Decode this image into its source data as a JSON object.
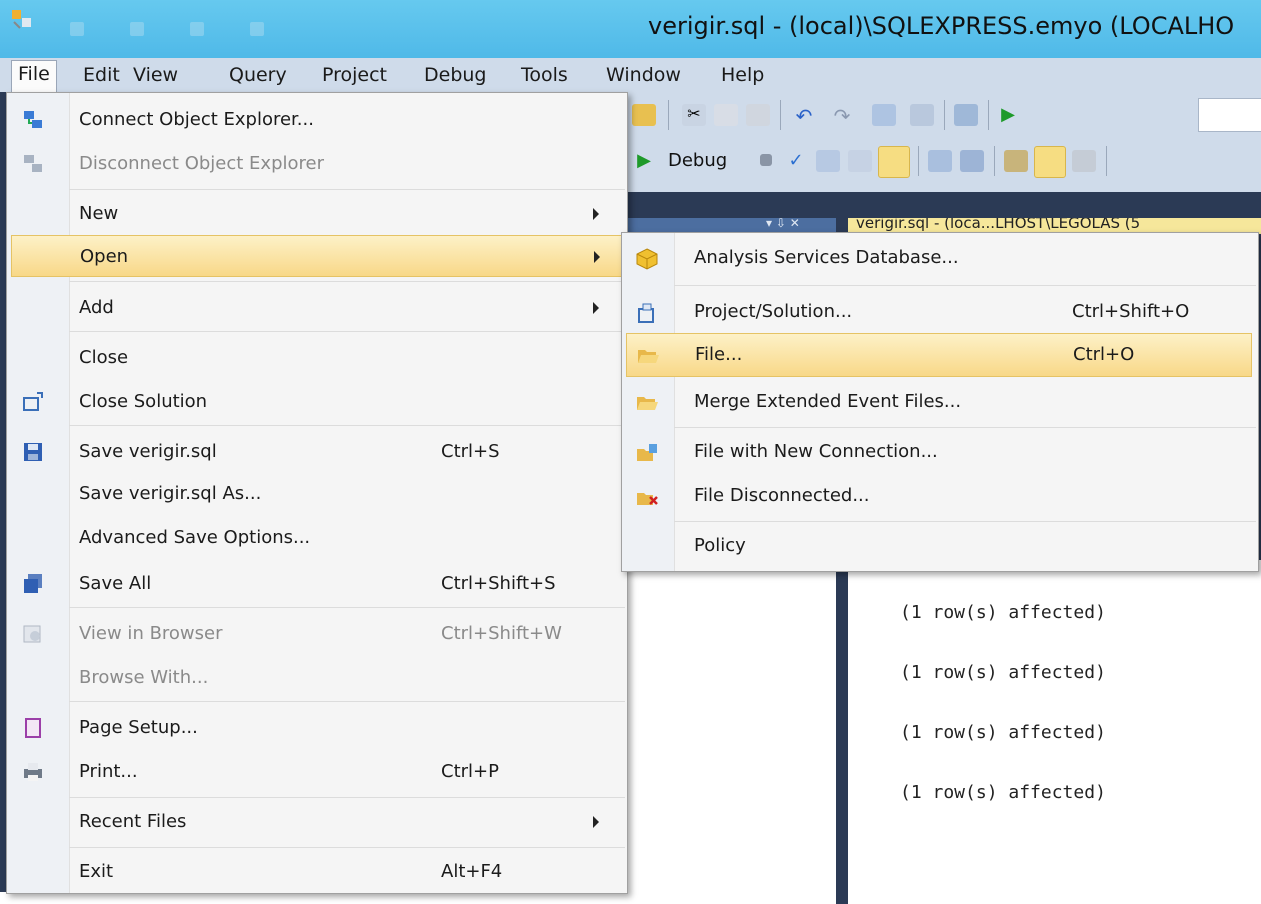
{
  "window": {
    "title": "verigir.sql - (local)\\SQLEXPRESS.emyo (LOCALHO"
  },
  "menubar": {
    "items": [
      "File",
      "Edit",
      "View",
      "Query",
      "Project",
      "Debug",
      "Tools",
      "Window",
      "Help"
    ],
    "active": "File"
  },
  "toolbar": {
    "debug_label": "Debug"
  },
  "panel": {
    "pin_label": "▾ ⇩ ✕"
  },
  "tab": {
    "title": "verigir.sql - (loca...LHOST\\LEGOLAS (5"
  },
  "file_menu": {
    "items": [
      {
        "label": "Connect Object Explorer...",
        "shortcut": "",
        "disabled": false
      },
      {
        "label": "Disconnect Object Explorer",
        "shortcut": "",
        "disabled": true
      },
      {
        "label": "New",
        "shortcut": "",
        "disabled": false
      },
      {
        "label": "Open",
        "shortcut": "",
        "disabled": false
      },
      {
        "label": "Add",
        "shortcut": "",
        "disabled": false
      },
      {
        "label": "Close",
        "shortcut": "",
        "disabled": false
      },
      {
        "label": "Close Solution",
        "shortcut": "",
        "disabled": false
      },
      {
        "label": "Save verigir.sql",
        "shortcut": "Ctrl+S",
        "disabled": false
      },
      {
        "label": "Save verigir.sql As...",
        "shortcut": "",
        "disabled": false
      },
      {
        "label": "Advanced Save Options...",
        "shortcut": "",
        "disabled": false
      },
      {
        "label": "Save All",
        "shortcut": "Ctrl+Shift+S",
        "disabled": false
      },
      {
        "label": "View in Browser",
        "shortcut": "Ctrl+Shift+W",
        "disabled": true
      },
      {
        "label": "Browse With...",
        "shortcut": "",
        "disabled": true
      },
      {
        "label": "Page Setup...",
        "shortcut": "",
        "disabled": false
      },
      {
        "label": "Print...",
        "shortcut": "Ctrl+P",
        "disabled": false
      },
      {
        "label": "Recent Files",
        "shortcut": "",
        "disabled": false
      },
      {
        "label": "Exit",
        "shortcut": "Alt+F4",
        "disabled": false
      }
    ]
  },
  "open_submenu": {
    "items": [
      {
        "label": "Analysis Services Database...",
        "shortcut": ""
      },
      {
        "label": "Project/Solution...",
        "shortcut": "Ctrl+Shift+O"
      },
      {
        "label": "File...",
        "shortcut": "Ctrl+O"
      },
      {
        "label": "Merge Extended Event Files...",
        "shortcut": ""
      },
      {
        "label": "File with New Connection...",
        "shortcut": ""
      },
      {
        "label": "File Disconnected...",
        "shortcut": ""
      },
      {
        "label": "Policy",
        "shortcut": ""
      }
    ],
    "highlighted": "File..."
  },
  "results": {
    "lines": [
      "(1 row(s) affected)",
      "(1 row(s) affected)",
      "(1 row(s) affected)",
      "(1 row(s) affected)"
    ]
  }
}
